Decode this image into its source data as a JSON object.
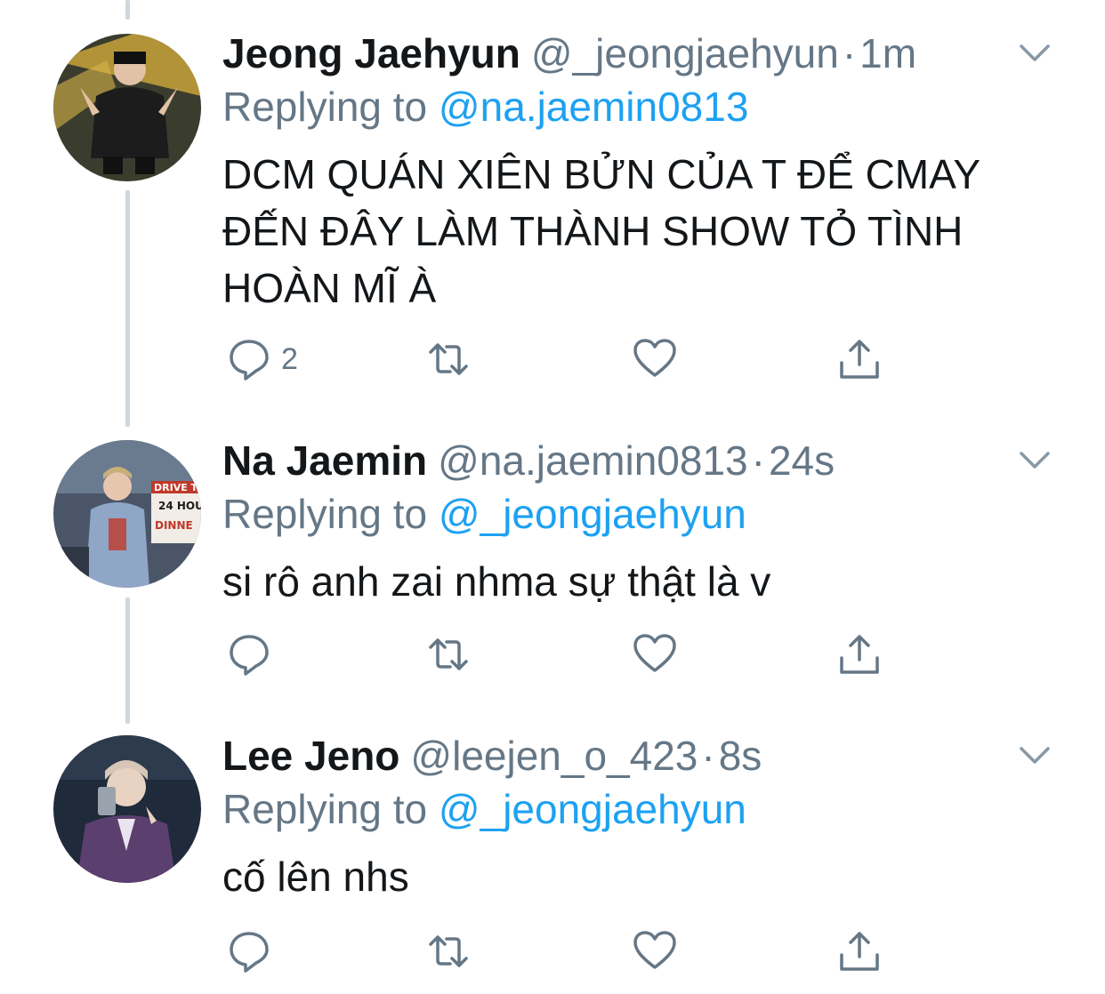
{
  "tweets": [
    {
      "name": "Jeong Jaehyun",
      "handle": "@_jeongjaehyun",
      "dot": "·",
      "time": "1m",
      "reply_prefix": "Replying to",
      "reply_to": "@na.jaemin0813",
      "text": "DCM QUÁN XIÊN BỬN CỦA T ĐỂ CMAY\nĐẾN ĐÂY LÀM THÀNH SHOW TỎ TÌNH\nHOÀN MĨ À",
      "reply_count": "2",
      "avatar_colors": [
        "#3a3d2e",
        "#c9a23a",
        "#1c1c1c"
      ]
    },
    {
      "name": "Na Jaemin",
      "handle": "@na.jaemin0813",
      "dot": "·",
      "time": "24s",
      "reply_prefix": "Replying to",
      "reply_to": "@_jeongjaehyun",
      "text": "si rô anh zai nhma sự thật là v",
      "reply_count": "",
      "avatar_colors": [
        "#4a5568",
        "#8fa6c6",
        "#c0392b"
      ],
      "avatar_sign": [
        "DRIVE T",
        "24 HOU",
        "DINNE"
      ]
    },
    {
      "name": "Lee Jeno",
      "handle": "@leejen_o_423",
      "dot": "·",
      "time": "8s",
      "reply_prefix": "Replying to",
      "reply_to": "@_jeongjaehyun",
      "text": "cố lên nhs",
      "reply_count": "",
      "avatar_colors": [
        "#1f2a3a",
        "#d7c6b8",
        "#5b3f6e"
      ]
    }
  ],
  "icons": {
    "reply": "reply-icon",
    "retweet": "retweet-icon",
    "like": "heart-icon",
    "share": "share-icon",
    "caret": "chevron-down-icon"
  },
  "colors": {
    "text": "#14171a",
    "secondary": "#657786",
    "link": "#1da1f2",
    "thread_line": "#cdd6dd"
  }
}
